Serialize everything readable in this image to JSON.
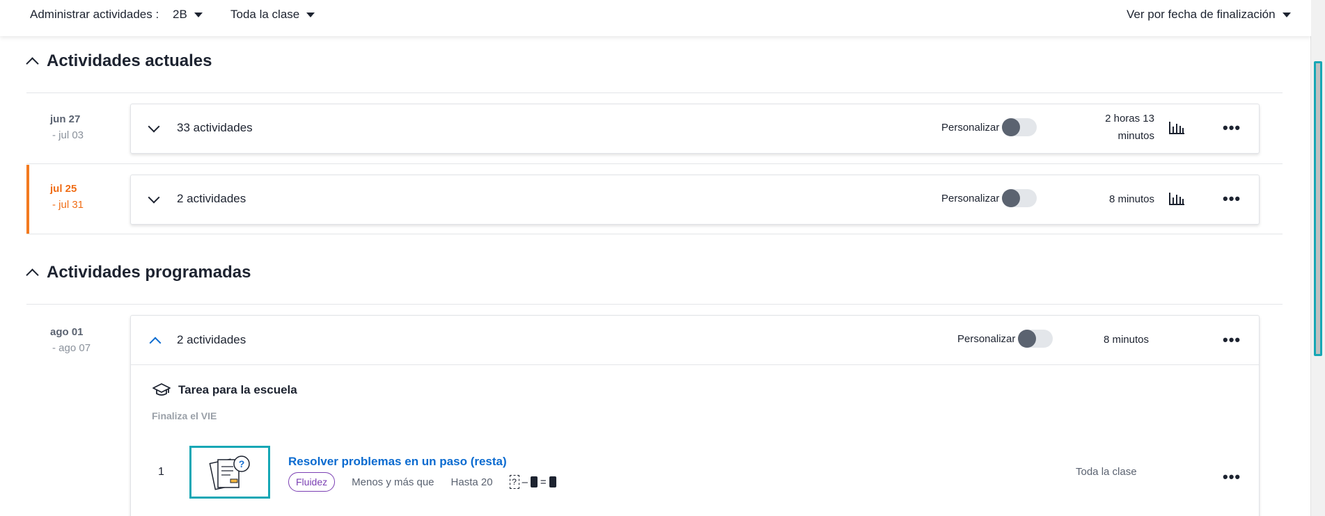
{
  "toolbar": {
    "label": "Administrar actividades :",
    "class_dropdown": "2B",
    "group_dropdown": "Toda la clase",
    "sort_dropdown": "Ver por fecha de finalización"
  },
  "sections": {
    "current_title": "Actividades actuales",
    "scheduled_title": "Actividades programadas"
  },
  "groups": [
    {
      "date_start": "jun 27",
      "date_end": "- jul 03",
      "count": "33 actividades",
      "personalize_label": "Personalizar",
      "duration_line1": "2 horas 13",
      "duration_line2": "minutos"
    },
    {
      "date_start": "jul 25",
      "date_end": "- jul 31",
      "count": "2 actividades",
      "personalize_label": "Personalizar",
      "duration": "8 minutos"
    },
    {
      "date_start": "ago 01",
      "date_end": "- ago 07",
      "count": "2 actividades",
      "personalize_label": "Personalizar",
      "duration": "8 minutos",
      "assignment_type": "Tarea para la escuela",
      "ends": "Finaliza el VIE",
      "items": [
        {
          "number": "1",
          "title": "Resolver problemas en un paso (resta)",
          "tag": "Fluidez",
          "category": "Menos y más que",
          "range": "Hasta 20",
          "assigned_to": "Toda la clase"
        }
      ]
    }
  ],
  "colors": {
    "accent_blue": "#0b6bd0",
    "active_orange": "#f06d16",
    "fluency_purple": "#7b3fb3",
    "thumb_teal": "#16a7b5"
  }
}
